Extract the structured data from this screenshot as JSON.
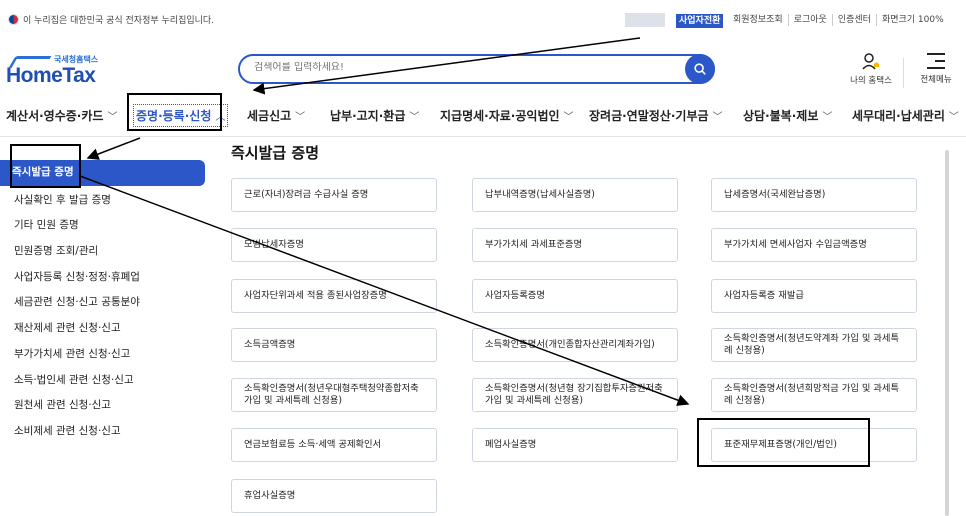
{
  "topbar": {
    "gov_notice": "이 누리집은 대한민국 공식 전자정부 누리집입니다.",
    "biz_switch": "사업자전환",
    "links": [
      "회원정보조회",
      "로그아웃",
      "인증센터",
      "화면크기 100%"
    ]
  },
  "header": {
    "logo_sub": "국세청홈택스",
    "logo_main": "HomeTax",
    "search_placeholder": "검색어를 입력하세요!",
    "myhome": "나의 홈택스",
    "allmenu": "전체메뉴"
  },
  "gnb": {
    "items": [
      {
        "label": "계산서·영수증·카드"
      },
      {
        "label": "증명·등록·신청"
      },
      {
        "label": "세금신고"
      },
      {
        "label": "납부·고지·환급"
      },
      {
        "label": "지급명세·자료·공익법인"
      },
      {
        "label": "장려금·연말정산·기부금"
      },
      {
        "label": "상담·불복·제보"
      },
      {
        "label": "세무대리·납세관리"
      }
    ]
  },
  "sidebar": {
    "items": [
      {
        "label": "즉시발급 증명"
      },
      {
        "label": "사실확인 후 발급 증명"
      },
      {
        "label": "기타 민원 증명"
      },
      {
        "label": "민원증명 조회/관리"
      },
      {
        "label": "사업자등록 신청·정정·휴폐업"
      },
      {
        "label": "세금관련 신청·신고 공통분야"
      },
      {
        "label": "재산제세 관련 신청·신고"
      },
      {
        "label": "부가가치세 관련 신청·신고"
      },
      {
        "label": "소득·법인세 관련 신청·신고"
      },
      {
        "label": "원천세 관련 신청·신고"
      },
      {
        "label": "소비제세 관련 신청·신고"
      }
    ]
  },
  "content": {
    "title": "즉시발급 증명",
    "cards": [
      "근로(자녀)장려금 수급사실 증명",
      "납부내역증명(납세사실증명)",
      "납세증명서(국세완납증명)",
      "모범납세자증명",
      "부가가치세 과세표준증명",
      "부가가치세 면세사업자 수입금액증명",
      "사업자단위과세 적용 종된사업장증명",
      "사업자등록증명",
      "사업자등록증 재발급",
      "소득금액증명",
      "소득확인증명서(개인종합자산관리계좌가입)",
      "소득확인증명서(청년도약계좌 가입 및 과세특례 신청용)",
      "소득확인증명서(청년우대형주택청약종합저축 가입 및 과세특례 신청용)",
      "소득확인증명서(청년형 장기집합투자증권저축 가입 및 과세특례 신청용)",
      "소득확인증명서(청년희망적금 가입 및 과세특례 신청용)",
      "연금보험료등 소득·세액 공제확인서",
      "폐업사실증명",
      "표준재무제표증명(개인/법인)",
      "휴업사실증명"
    ]
  }
}
